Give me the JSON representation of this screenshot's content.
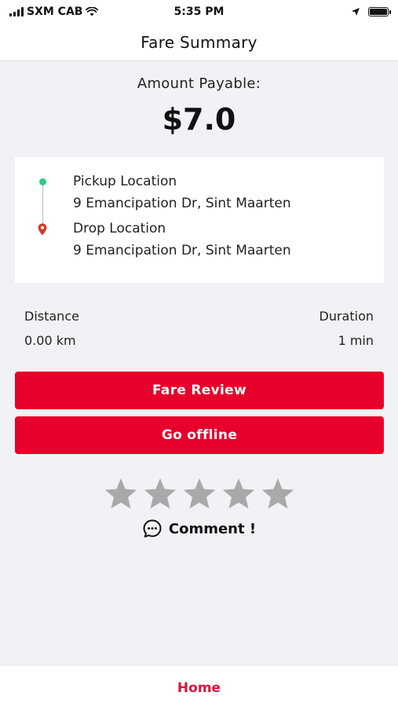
{
  "status_bar": {
    "carrier": "SXM CAB",
    "time": "5:35 PM",
    "icons": [
      "signal-icon",
      "wifi-icon",
      "location-arrow-icon",
      "battery-icon"
    ]
  },
  "header": {
    "title": "Fare Summary"
  },
  "fare": {
    "label": "Amount Payable:",
    "amount": "$7.0"
  },
  "trip": {
    "pickup": {
      "title": "Pickup Location",
      "address": "9 Emancipation Dr, Sint Maarten"
    },
    "drop": {
      "title": "Drop Location",
      "address": "9 Emancipation Dr, Sint Maarten"
    }
  },
  "stats": {
    "distance_label": "Distance",
    "distance_value": "0.00 km",
    "duration_label": "Duration",
    "duration_value": "1 min"
  },
  "actions": {
    "fare_review": "Fare Review",
    "go_offline": "Go offline"
  },
  "rating": {
    "stars_total": 5,
    "stars_selected": 0
  },
  "comment": {
    "label": "Comment !"
  },
  "nav": {
    "home": "Home"
  },
  "colors": {
    "accent": "#e8002c",
    "home_tab": "#d4163a",
    "pickup_dot": "#2ecc80",
    "drop_pin": "#d9342b",
    "star_inactive": "#a9a9a9",
    "background": "#f0f2f6"
  }
}
